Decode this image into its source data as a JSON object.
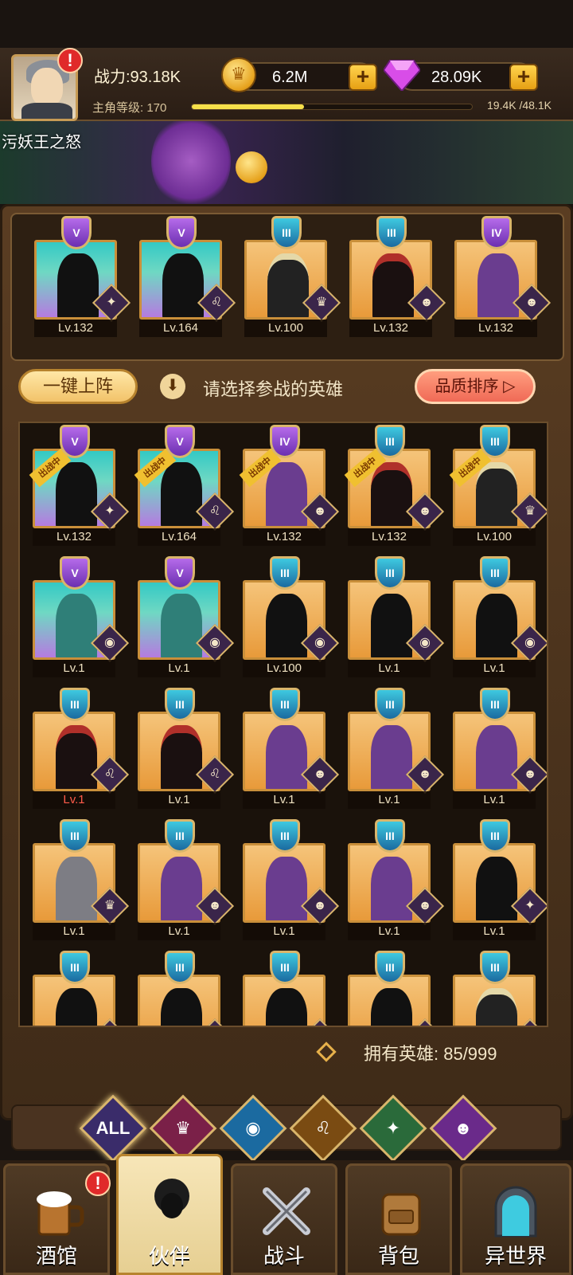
{
  "header": {
    "power": "战力:93.18K",
    "level_label": "主角等级: 170",
    "level_progress": 0.4,
    "exp": "19.4K /48.1K",
    "gold": "6.2M",
    "gems": "28.09K"
  },
  "scene": {
    "title": "污妖王之怒"
  },
  "team": {
    "members": [
      {
        "rank": "V",
        "level": "Lv.132"
      },
      {
        "rank": "V",
        "level": "Lv.164"
      },
      {
        "rank": "III",
        "level": "Lv.100"
      },
      {
        "rank": "III",
        "level": "Lv.132"
      },
      {
        "rank": "IV",
        "level": "Lv.132"
      }
    ]
  },
  "controls": {
    "deploy_label": "一键上阵",
    "hint": "请选择参战的英雄",
    "sort_label": "品质排序 ▷"
  },
  "roster": {
    "deployed_tag": "出战中",
    "rows": [
      [
        {
          "rank": "V",
          "level": "Lv.132"
        },
        {
          "rank": "V",
          "level": "Lv.164"
        },
        {
          "rank": "IV",
          "level": "Lv.132"
        },
        {
          "rank": "III",
          "level": "Lv.132"
        },
        {
          "rank": "III",
          "level": "Lv.100"
        }
      ],
      [
        {
          "rank": "V",
          "level": "Lv.1"
        },
        {
          "rank": "V",
          "level": "Lv.1"
        },
        {
          "rank": "III",
          "level": "Lv.100"
        },
        {
          "rank": "III",
          "level": "Lv.1"
        },
        {
          "rank": "III",
          "level": "Lv.1"
        }
      ],
      [
        {
          "rank": "III",
          "level": "Lv.1"
        },
        {
          "rank": "III",
          "level": "Lv.1"
        },
        {
          "rank": "III",
          "level": "Lv.1"
        },
        {
          "rank": "III",
          "level": "Lv.1"
        },
        {
          "rank": "III",
          "level": "Lv.1"
        }
      ],
      [
        {
          "rank": "III",
          "level": "Lv.1"
        },
        {
          "rank": "III",
          "level": "Lv.1"
        },
        {
          "rank": "III",
          "level": "Lv.1"
        },
        {
          "rank": "III",
          "level": "Lv.1"
        },
        {
          "rank": "III",
          "level": "Lv.1"
        }
      ],
      [
        {
          "rank": "III"
        },
        {
          "rank": "III"
        },
        {
          "rank": "III"
        },
        {
          "rank": "III"
        },
        {
          "rank": "III"
        }
      ]
    ]
  },
  "hero_count": "拥有英雄: 85/999",
  "filters": [
    "ALL",
    "",
    "",
    "",
    "",
    ""
  ],
  "nav": {
    "tabs": [
      {
        "label": "酒馆"
      },
      {
        "label": "伙伴"
      },
      {
        "label": "战斗"
      },
      {
        "label": "背包"
      },
      {
        "label": "异世界"
      }
    ]
  },
  "colors": {
    "accent": "#c98f3a",
    "panel": "#3f2b18",
    "sort_button": "#f06a56"
  }
}
